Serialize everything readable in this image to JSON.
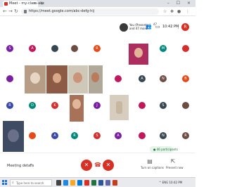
{
  "browser": {
    "tab_title": "Meet - my-class-abc",
    "tab_close": "×",
    "new_tab": "+",
    "window_controls": "– ☐ ×",
    "url": "https://meet.google.com/abc-defg-hij"
  },
  "meet_header": {
    "self_name": "You (Presenter)\nand 47 more",
    "badge": "47",
    "time": "10:42 PM",
    "avatar_letter": "R"
  },
  "participants": {
    "avatar_letters": [
      "S",
      "A",
      "",
      "",
      "R",
      "S",
      "M",
      "",
      "",
      "",
      "A",
      "N",
      "B",
      "R",
      "D",
      "K",
      "J",
      "",
      "S",
      "",
      "",
      "A",
      "R",
      "S",
      "A",
      "",
      "N",
      "R",
      "D",
      "",
      "A",
      "B",
      "",
      "V"
    ],
    "colors": {
      "purple": "#7b1fa2",
      "pink": "#c2185b",
      "indigo": "#3949ab",
      "orange": "#e64a19",
      "teal": "#00897b",
      "brown": "#6d4c41",
      "dark": "#37474f",
      "red": "#d32f2f"
    }
  },
  "bottom_bar": {
    "meeting_details": "Meeting details",
    "caret": "^",
    "pinned": "● 46 participants",
    "mic_icon": "mic-off-icon",
    "end_call_icon": "phone-hangup-icon",
    "cam_icon": "camera-off-icon",
    "captions_label": "Turn on captions",
    "present_label": "Present now",
    "captions_glyph": "▤",
    "present_glyph": "⇱"
  },
  "taskbar": {
    "search_placeholder": "Type here to search",
    "search_glyph": "⌕",
    "tray_text": "^ ENG 10:42 PM"
  },
  "accent": {
    "red": "#d93025",
    "white": "#ffffff"
  }
}
